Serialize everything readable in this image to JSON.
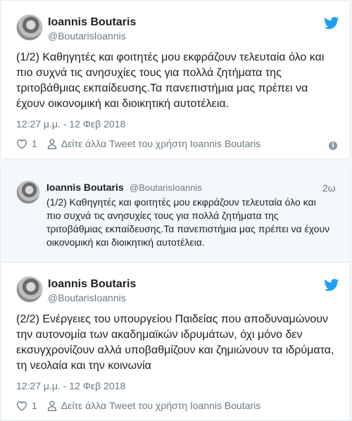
{
  "tweet1": {
    "author_name": "Ioannis Boutaris",
    "author_handle": "@BoutarisIoannis",
    "lines": [
      "(1/2) Καθηγητές και φοιτητές μου εκφράζουν τελευταία όλο και",
      "πιο συχνά τις ανησυχίες τους για πολλά ζητήματα της",
      "τριτοβάθμιας εκπαίδευσης.Τα πανεπιστήμια μας πρέπει να",
      "έχουν οικονομική και διοικητική αυτοτέλεια."
    ],
    "timestamp": "12:27 μ.μ. - 12 Φεβ 2018",
    "like_count": "1",
    "view_more": "Δείτε άλλα Tweet του χρήστη Ioannis Boutaris"
  },
  "quoted": {
    "author_name": "Ioannis Boutaris",
    "author_handle": "@BoutarisIoannis",
    "time_ago": "2ω",
    "lines": [
      "(1/2) Καθηγητές και φοιτητές μου εκφράζουν τελευταία όλο και",
      "πιο συχνά τις ανησυχίες τους για πολλά ζητήματα της",
      "τριτοβάθμιας εκπαίδευσης.Τα πανεπιστήμια μας πρέπει να έχουν",
      "οικονομική και διοικητική αυτοτέλεια."
    ]
  },
  "tweet2": {
    "author_name": "Ioannis Boutaris",
    "author_handle": "@BoutarisIoannis",
    "lines": [
      "(2/2) Ενέργειες του υπουργείου Παιδείας που αποδυναμώνουν",
      "την αυτονομία των ακαδημαϊκών ιδρυμάτων, όχι μόνο δεν",
      "εκσυγχρονίζουν αλλά υποβαθμίζουν και ζημιώνουν τα ιδρύματα,",
      "τη νεολαία και την κοινωνία"
    ],
    "timestamp": "12:27 μ.μ. - 12 Φεβ 2018",
    "like_count": "1",
    "view_more": "Δείτε άλλα Tweet του χρήστη Ioannis Boutaris"
  },
  "colors": {
    "twitter_blue": "#1da1f2",
    "muted": "#697882",
    "text": "#1c2022"
  }
}
